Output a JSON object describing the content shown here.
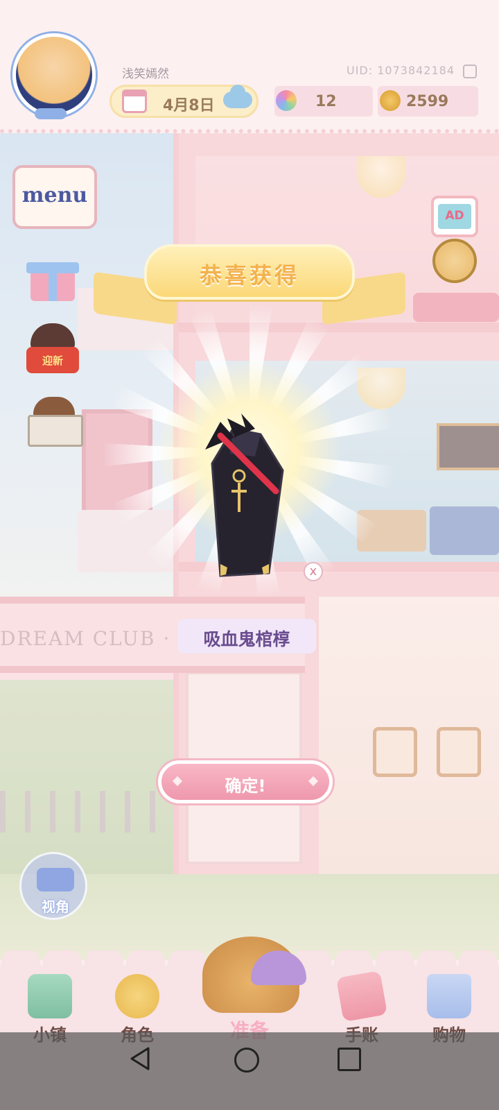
{
  "header": {
    "username": "浅笑嫣然",
    "uid": "UID: 1073842184",
    "date": "4月8日",
    "weather_icon": "cloud-icon",
    "gems": "12",
    "coins": "2599"
  },
  "side": {
    "menu_label": "menu",
    "newyear_label": "迎新",
    "view_label": "视角",
    "ad_label": "AD"
  },
  "scene": {
    "club_sign": "DREAM CLUB ·"
  },
  "reward": {
    "banner": "恭喜获得",
    "item_name": "吸血鬼棺椁",
    "close": "x",
    "confirm": "确定!"
  },
  "nav": {
    "items": [
      {
        "label": "小镇",
        "icon": "map-icon"
      },
      {
        "label": "角色",
        "icon": "character-icon"
      },
      {
        "label": "准备",
        "icon": "basket-icon"
      },
      {
        "label": "手账",
        "icon": "journal-icon"
      },
      {
        "label": "购物",
        "icon": "shopping-bag-icon"
      }
    ]
  },
  "colors": {
    "accent_pink": "#ef98ad",
    "banner_gold": "#fbd878",
    "item_purple": "#6a4d8f"
  }
}
